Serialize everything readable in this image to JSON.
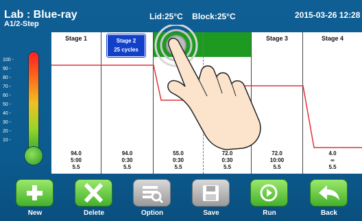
{
  "header": {
    "title": "Lab : Blue-ray",
    "subtitle": "A1/2-Step",
    "lid": "Lid:25°C",
    "block": "Block:25°C",
    "datetime": "2015-03-26 12:28"
  },
  "y_ticks": [
    "100 -",
    "90 -",
    "80 -",
    "70 -",
    "60 -",
    "50 -",
    "40 -",
    "30 -",
    "20 -",
    "10 -"
  ],
  "stages": [
    {
      "name": "Stage 1",
      "temp": "94.0",
      "time": "5:00",
      "ramp": "5.5"
    },
    {
      "name": "Stage 2",
      "cycles": "25 cycles",
      "temp": "94.0",
      "time": "0:30",
      "ramp": "5.5"
    },
    {
      "name": "",
      "temp": "55.0",
      "time": "0:30",
      "ramp": "5.5"
    },
    {
      "name": "",
      "temp": "72.0",
      "time": "0:30",
      "ramp": "5.5"
    },
    {
      "name": "Stage 3",
      "temp": "72.0",
      "time": "10:00",
      "ramp": "5.5"
    },
    {
      "name": "Stage 4",
      "temp": "4.0",
      "time": "∞",
      "ramp": "5.5"
    }
  ],
  "toolbar": {
    "new": "New",
    "delete": "Delete",
    "option": "Option",
    "save": "Save",
    "run": "Run",
    "back": "Back"
  },
  "colors": {
    "background": "#0f5f95",
    "button_green": "#44b02c",
    "selected_stage": "#1240c8",
    "cycle_band": "#1e9a22",
    "trace": "#e0303a"
  }
}
